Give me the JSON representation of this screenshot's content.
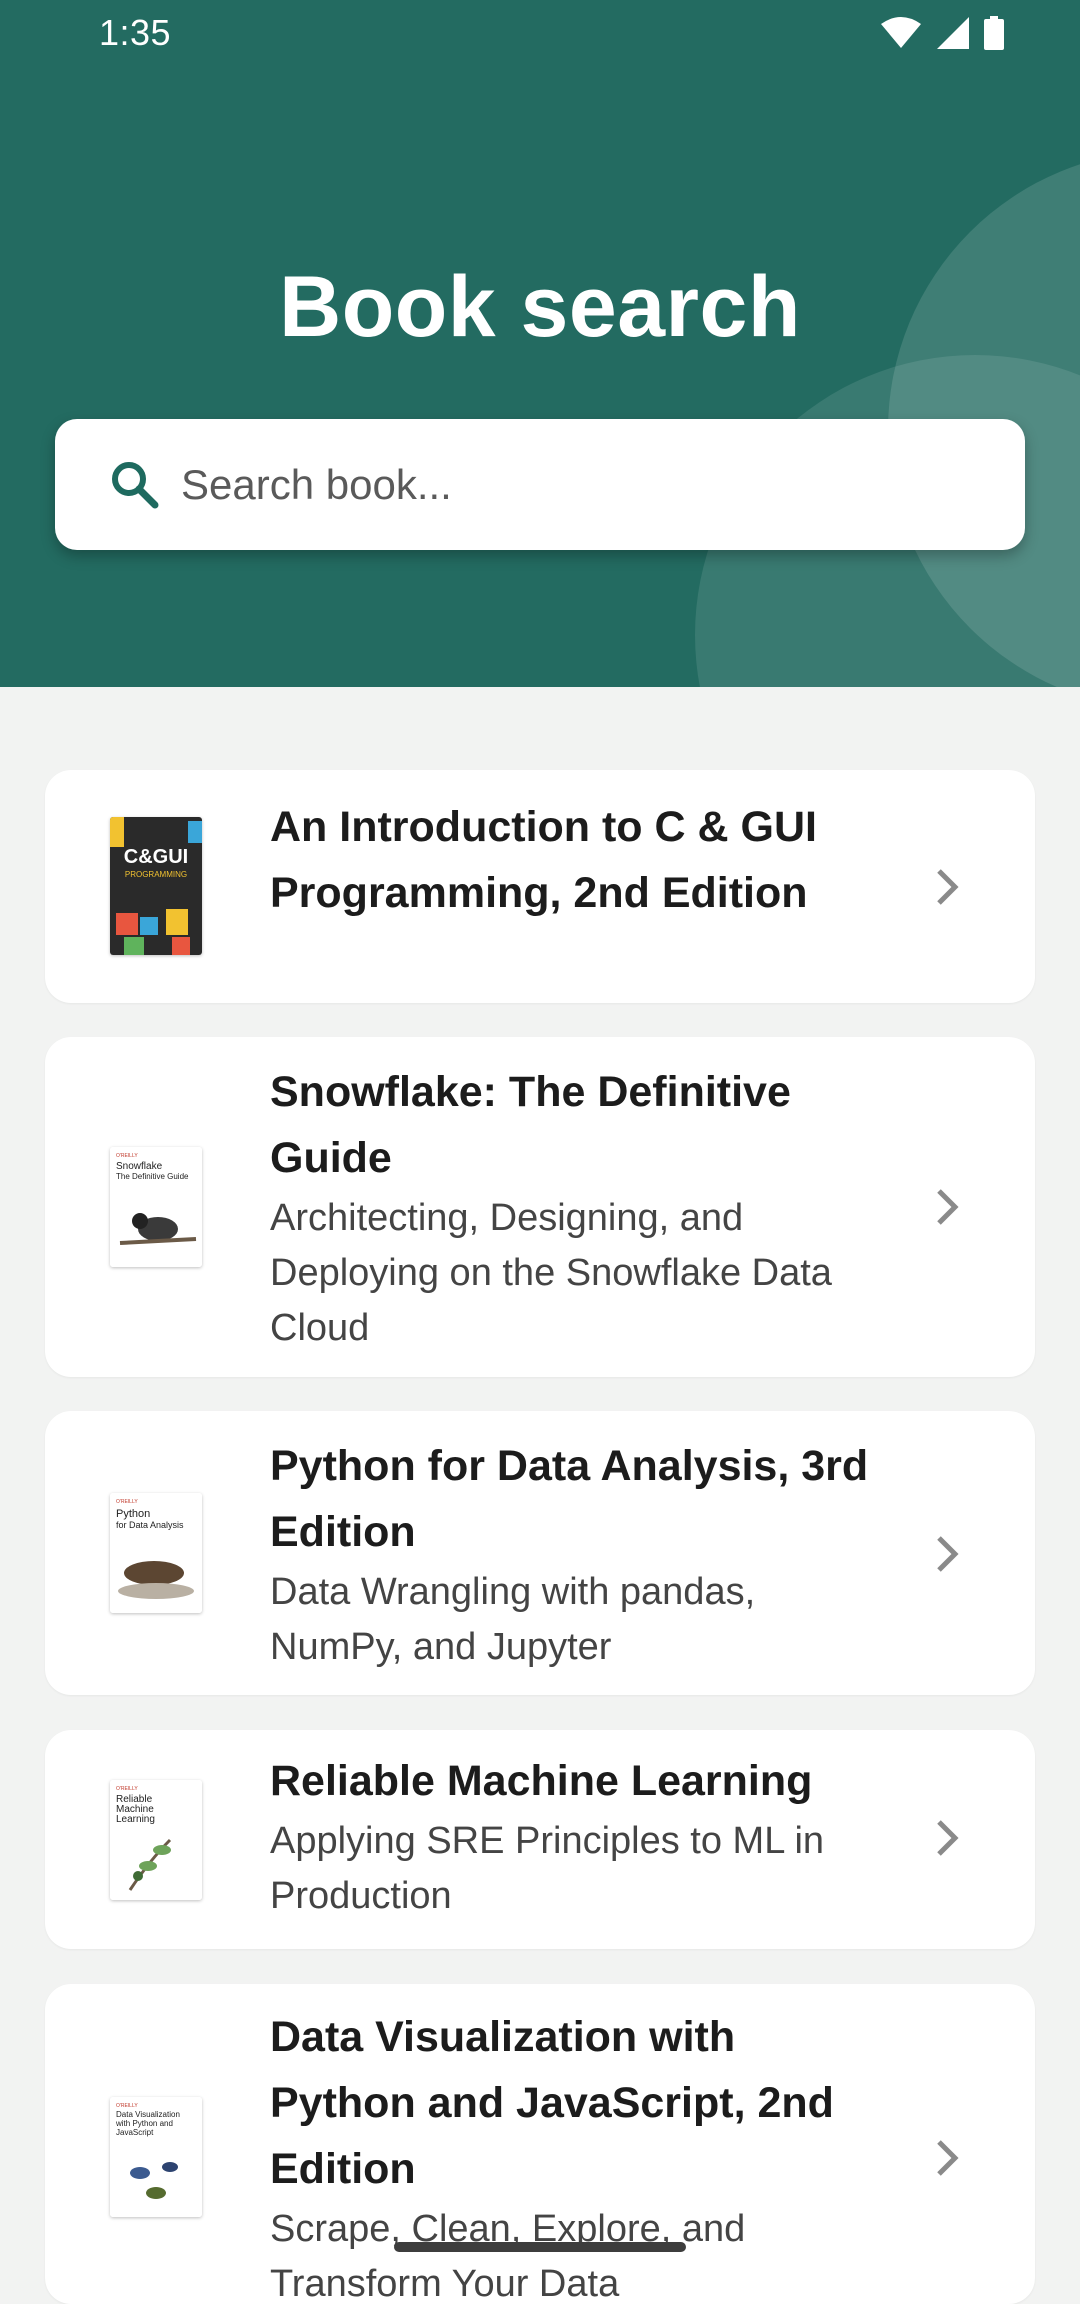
{
  "status_bar": {
    "time": "1:35"
  },
  "header": {
    "title": "Book search"
  },
  "search": {
    "placeholder": "Search book..."
  },
  "books": [
    {
      "title": "An Introduction to C & GUI Programming, 2nd Edition",
      "subtitle": "",
      "cover_icon": "book-cover-c-gui"
    },
    {
      "title": "Snowflake: The Definitive Guide",
      "subtitle": "Architecting, Designing, and Deploying on the Snowflake Data Cloud",
      "cover_icon": "book-cover-snowflake"
    },
    {
      "title": "Python for Data Analysis, 3rd Edition",
      "subtitle": "Data Wrangling with pandas, NumPy, and Jupyter",
      "cover_icon": "book-cover-python"
    },
    {
      "title": "Reliable Machine Learning",
      "subtitle": "Applying SRE Principles to ML in Production",
      "cover_icon": "book-cover-reliable-ml"
    },
    {
      "title": "Data Visualization with Python and JavaScript, 2nd Edition",
      "subtitle": "Scrape, Clean, Explore, and Transform Your Data",
      "cover_icon": "book-cover-data-viz"
    }
  ],
  "colors": {
    "header": "#236b61",
    "accent": "#1e6a5f",
    "background": "#f2f3f2"
  }
}
